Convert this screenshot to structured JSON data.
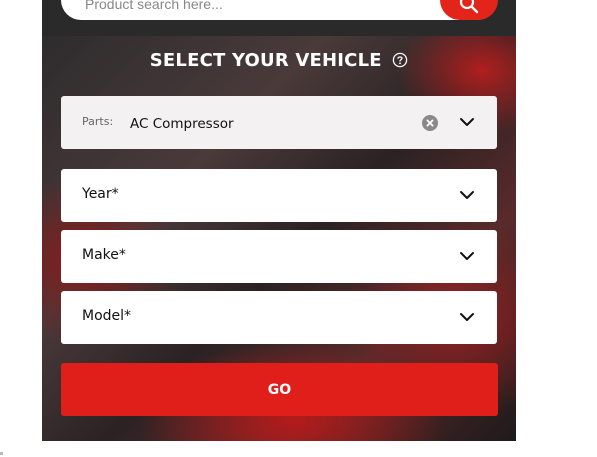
{
  "search": {
    "placeholder": "Product search here...",
    "button_icon": "search-icon"
  },
  "vehicle_selector": {
    "title": "SELECT YOUR VEHICLE",
    "help_icon": "question-circle-icon",
    "parts": {
      "label": "Parts:",
      "value": "AC Compressor",
      "clear_icon": "clear-circle-icon",
      "chevron_icon": "chevron-down-icon"
    },
    "fields": [
      {
        "label": "Year*"
      },
      {
        "label": "Make*"
      },
      {
        "label": "Model*"
      }
    ],
    "go_label": "GO"
  },
  "colors": {
    "accent": "#e01f1b",
    "header_bg": "#2a2a2a",
    "field_bg": "#ffffff",
    "parts_field_bg": "#f3f1f1"
  }
}
